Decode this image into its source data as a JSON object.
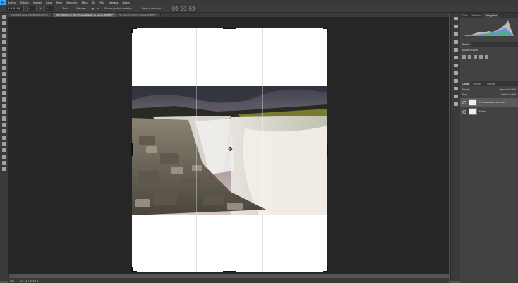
{
  "menubar": {
    "app_icon": "Ps",
    "items": [
      "Archivo",
      "Edición",
      "Imagen",
      "Capa",
      "Texto",
      "Selección",
      "Filtro",
      "3D",
      "Vista",
      "Ventana",
      "Ayuda"
    ]
  },
  "options": {
    "ratio": "4 : 5 (8 : 10)",
    "width": "4",
    "height": "5",
    "clear_label": "Borrar",
    "straighten_label": "Enderezar",
    "delete_pixels_label": "Eliminar píxeles recortados",
    "content_aware_label": "Según el contenido"
  },
  "tabs": [
    {
      "label": "ZNCJ6010.jpg al 16% (RGB/8*/CMYK) ×",
      "active": false
    },
    {
      "label": "ZNCJ6018.jpg al 16% (Previsualización de recorte, RGB/8) *",
      "active": true
    },
    {
      "label": "Sin título-1 al 66,7% (Capa 2, RGB/8*) ×",
      "active": false
    }
  ],
  "status": {
    "zoom": "16%",
    "doc": "Doc: 14,0 M/73,4 M"
  },
  "panels": {
    "top_tabs": [
      "Color",
      "Muestras",
      "Histograma"
    ],
    "adjust_title": "Ajustes",
    "adjust_sub": "Añadir un ajuste",
    "layer_tabs": [
      "Capas",
      "Canales",
      "Trazados"
    ],
    "blend_mode": "Normal",
    "opacity_label": "Opacidad:",
    "opacity": "100%",
    "lock_label": "Bloq:",
    "fill_label": "Relleno:",
    "fill": "100%",
    "layers": [
      {
        "name": "Previsualización de recorte",
        "selected": true
      },
      {
        "name": "Fondo",
        "selected": false
      }
    ]
  }
}
